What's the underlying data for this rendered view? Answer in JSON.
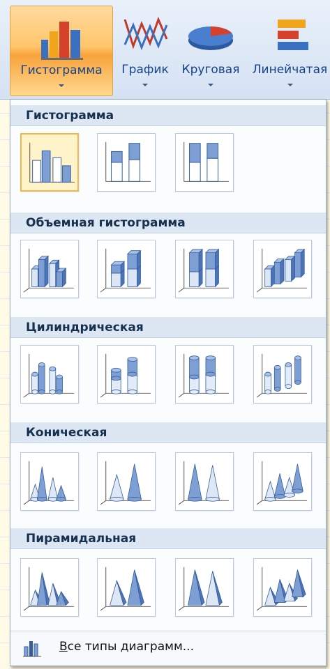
{
  "ribbon": {
    "buttons": [
      {
        "label": "Гистограмма",
        "icon": "column-chart-icon",
        "active": true
      },
      {
        "label": "График",
        "icon": "line-chart-icon",
        "active": false
      },
      {
        "label": "Круговая",
        "icon": "pie-chart-icon",
        "active": false
      },
      {
        "label": "Линейчатая",
        "icon": "bar-chart-icon",
        "active": false
      }
    ]
  },
  "gallery": {
    "sections": [
      {
        "title": "Гистограмма",
        "items": [
          "clustered-column-icon",
          "stacked-column-icon",
          "100-percent-stacked-column-icon"
        ]
      },
      {
        "title": "Объемная гистограмма",
        "items": [
          "3d-clustered-column-icon",
          "3d-stacked-column-icon",
          "3d-100-percent-stacked-column-icon",
          "3d-column-icon"
        ]
      },
      {
        "title": "Цилиндрическая",
        "items": [
          "clustered-cylinder-icon",
          "stacked-cylinder-icon",
          "100-percent-stacked-cylinder-icon",
          "3d-cylinder-icon"
        ]
      },
      {
        "title": "Коническая",
        "items": [
          "clustered-cone-icon",
          "stacked-cone-icon",
          "100-percent-stacked-cone-icon",
          "3d-cone-icon"
        ]
      },
      {
        "title": "Пирамидальная",
        "items": [
          "clustered-pyramid-icon",
          "stacked-pyramid-icon",
          "100-percent-stacked-pyramid-icon",
          "3d-pyramid-icon"
        ]
      }
    ],
    "footer_label": "Все типы диаграмм..."
  },
  "colors": {
    "accent": "#f8a33b",
    "label_blue": "#15428b",
    "header_bg": "#dde7f3"
  }
}
